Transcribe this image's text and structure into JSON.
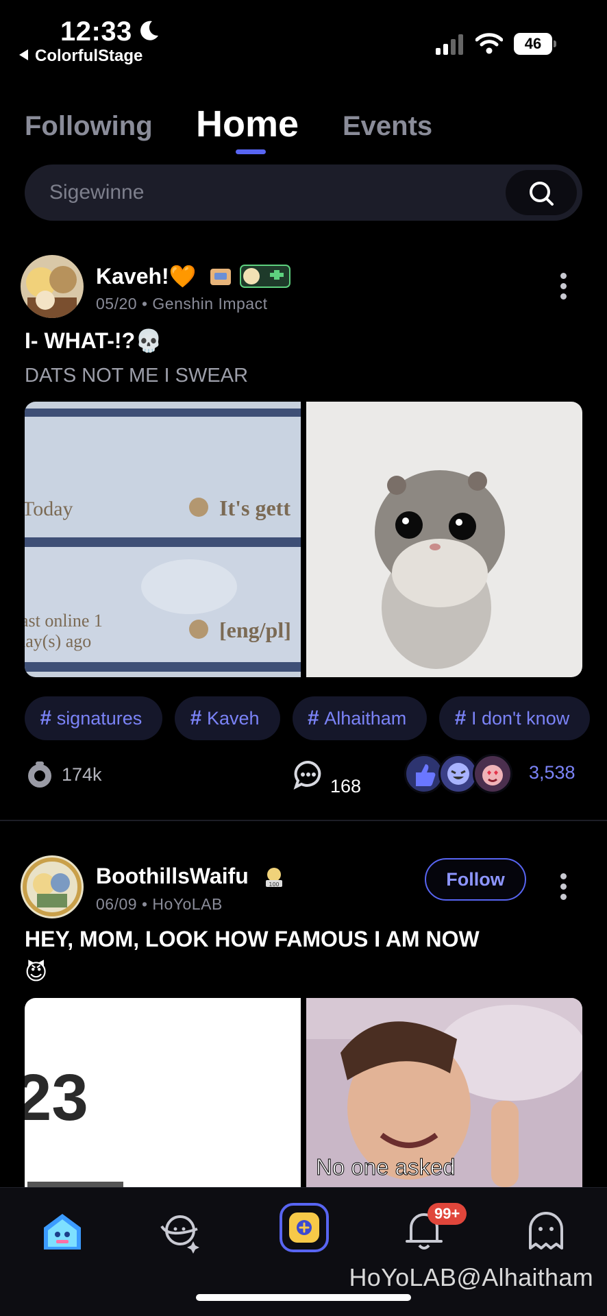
{
  "status_bar": {
    "time": "12:33",
    "back_app": "ColorfulStage",
    "battery": "46"
  },
  "tabs": [
    {
      "label": "Following",
      "active": false
    },
    {
      "label": "Home",
      "active": true
    },
    {
      "label": "Events",
      "active": false
    }
  ],
  "search": {
    "placeholder": "Sigewinne",
    "icon": "search-icon"
  },
  "posts": [
    {
      "author": "Kaveh!🧡",
      "date": "05/20",
      "game": "Genshin Impact",
      "meta": "05/20 • Genshin Impact",
      "title": "I- WHAT-!?💀",
      "subtitle": "DATS NOT ME I SWEAR",
      "image_left_text": [
        "Today",
        "It's gett",
        "ast online 1",
        "lay(s) ago",
        "[eng/pl]"
      ],
      "tags": [
        "signatures",
        "Kaveh",
        "Alhaitham",
        "I don't know"
      ],
      "views": "174k",
      "comments": "168",
      "reactions": "3,538"
    },
    {
      "author": "BoothillsWaifu",
      "date": "06/09",
      "game": "HoYoLAB",
      "meta": "06/09 • HoYoLAB",
      "follow_label": "Follow",
      "title": "HEY, MOM, LOOK HOW FAMOUS I AM NOW",
      "title_emoji": "😈",
      "image_left_text": "23",
      "image_right_caption": "No one asked"
    }
  ],
  "bottom_nav": {
    "items": [
      "home-icon",
      "explore-icon",
      "create-post-icon",
      "notification-icon",
      "profile-icon"
    ],
    "notification_badge": "99+"
  },
  "watermark": "HoYoLAB@Alhaitham",
  "colors": {
    "accent": "#5865f2",
    "background": "#000000",
    "chip_bg": "#15172a",
    "chip_text": "#7b83f7"
  }
}
